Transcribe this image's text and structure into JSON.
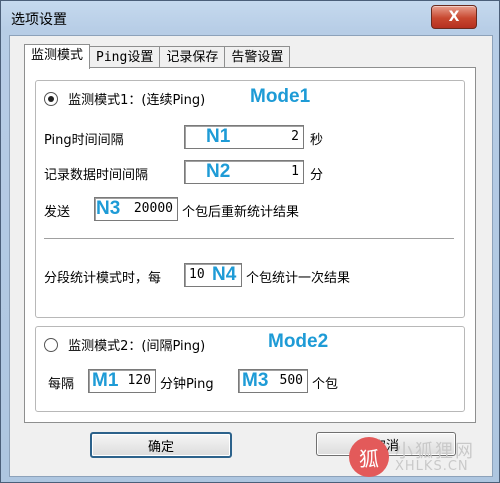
{
  "window": {
    "title": "选项设置",
    "close_label": "X"
  },
  "tabs": [
    {
      "label": "监测模式"
    },
    {
      "label": "Ping设置"
    },
    {
      "label": "记录保存"
    },
    {
      "label": "告警设置"
    }
  ],
  "mode1": {
    "label": "监测模式1：(连续Ping)",
    "selected": true,
    "annotation": "Mode1",
    "ping_interval": {
      "label": "Ping时间间隔",
      "value": "2",
      "unit": "秒",
      "annotation": "N1"
    },
    "record_interval": {
      "label": "记录数据时间间隔",
      "value": "1",
      "unit": "分",
      "annotation": "N2"
    },
    "send": {
      "prefix": "发送",
      "value": "20000",
      "suffix": "个包后重新统计结果",
      "annotation": "N3"
    },
    "segment": {
      "prefix": "分段统计模式时，每",
      "value": "10",
      "suffix": "个包统计一次结果",
      "annotation": "N4"
    }
  },
  "mode2": {
    "label": "监测模式2：(间隔Ping)",
    "selected": false,
    "annotation": "Mode2",
    "prefix": "每隔",
    "interval_value": "120",
    "interval_annotation": "M1",
    "mid": "分钟Ping",
    "count_value": "500",
    "count_annotation": "M3",
    "suffix": "个包"
  },
  "buttons": {
    "ok": "确定",
    "cancel": "取消"
  },
  "watermark": {
    "text1": "小狐狸网",
    "text2": "XHLKS.CN",
    "glyph": "狐"
  }
}
